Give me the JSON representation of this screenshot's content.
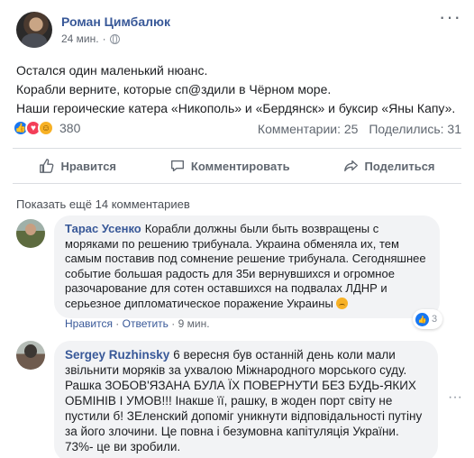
{
  "post": {
    "author": "Роман Цимбалюк",
    "time": "24 мин.",
    "lines": [
      "Остался один маленький нюанс.",
      "Корабли верните, которые сп@здили в Чёрном море.",
      "Наши героические катера «Никополь» и «Бердянск» и буксир «Яны Капу»."
    ],
    "reaction_count": "380",
    "comments_count": "Комментарии: 25",
    "shares_count": "Поделились: 31",
    "reaction_icons": [
      "like-icon",
      "love-icon",
      "haha-icon"
    ]
  },
  "actions": {
    "like": "Нравится",
    "comment": "Комментировать",
    "share": "Поделиться"
  },
  "comments": {
    "more": "Показать ещё 14 комментариев",
    "items": [
      {
        "name": "Тарас Усенко",
        "text": "Корабли должны были быть возвращены с моряками по решению трибунала. Украина обменяла их, тем самым поставив под сомнение решение трибунала. Сегодняшнее событие большая радость для 35и вернувшихся и огромное разочарование для сотен оставшихся на подвалах ЛДНР и серьезное дипломатическое поражение Украины",
        "like": "Нравится",
        "reply": "Ответить",
        "time": "9 мин.",
        "reactions": "3"
      },
      {
        "name": "Sergey Ruzhinsky",
        "text": "6 вересня був останній день коли мали звільнити моряків за ухвалою Міжнародного морського суду. Рашка ЗОБОВ'ЯЗАНА БУЛА ЇХ ПОВЕРНУТИ БЕЗ БУДЬ-ЯКИХ ОБМІНІВ І УМОВ!!! Інакше її, рашку, в жоден порт світу не пустили б! ЗЕленский допоміг уникнути відповідальності путіну за його злочини. Це повна і безумовна капітуляція України. 73%- це ви зробили."
      }
    ]
  },
  "colors": {
    "link": "#385898",
    "like_blue": "#1877f2",
    "bubble": "#f2f3f5"
  }
}
